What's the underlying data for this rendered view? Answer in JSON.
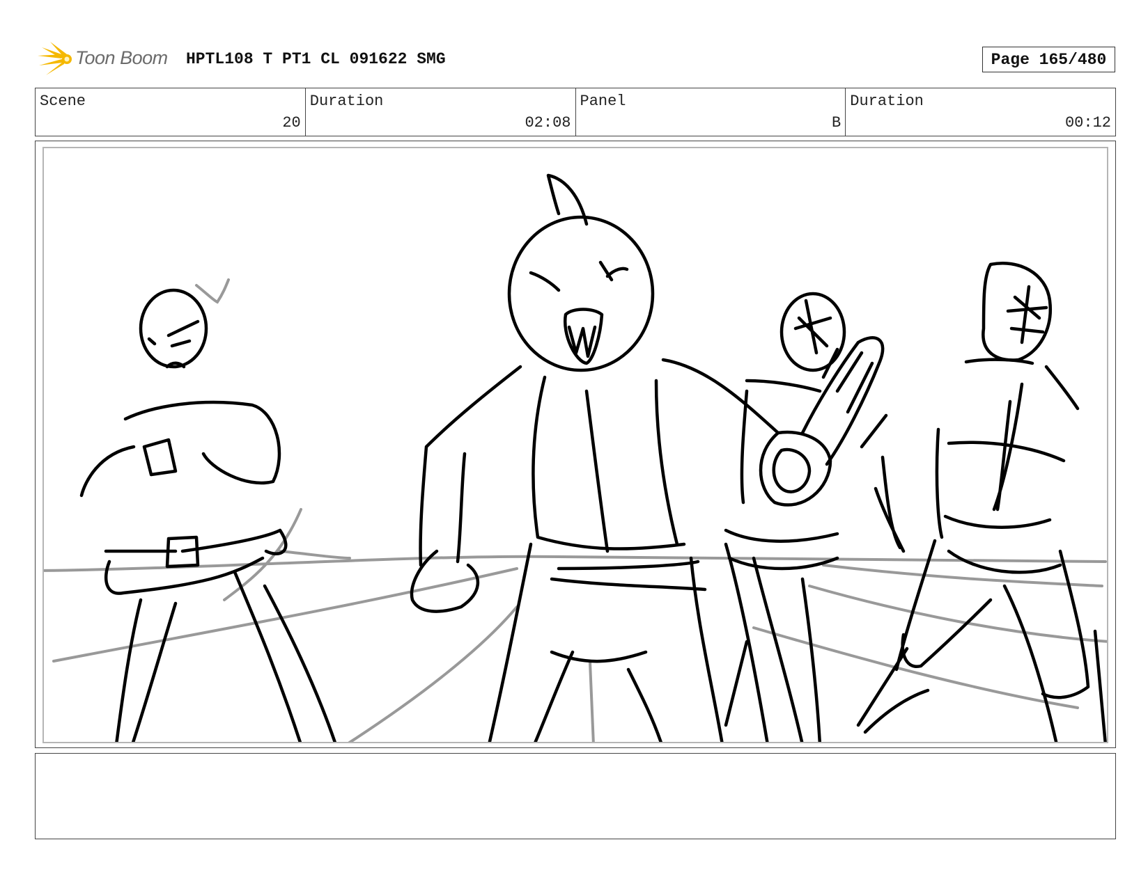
{
  "header": {
    "logo_text": "Toon Boom",
    "document_title": "HPTL108 T PT1 CL 091622 SMG",
    "page_label": "Page 165/480"
  },
  "info": {
    "scene_label": "Scene",
    "scene_value": "20",
    "scene_duration_label": "Duration",
    "scene_duration_value": "02:08",
    "panel_label": "Panel",
    "panel_value": "B",
    "panel_duration_label": "Duration",
    "panel_duration_value": "00:12"
  },
  "colors": {
    "logo_accent": "#f5b800",
    "sketch_ink": "#000000",
    "sketch_guide": "#999999"
  }
}
